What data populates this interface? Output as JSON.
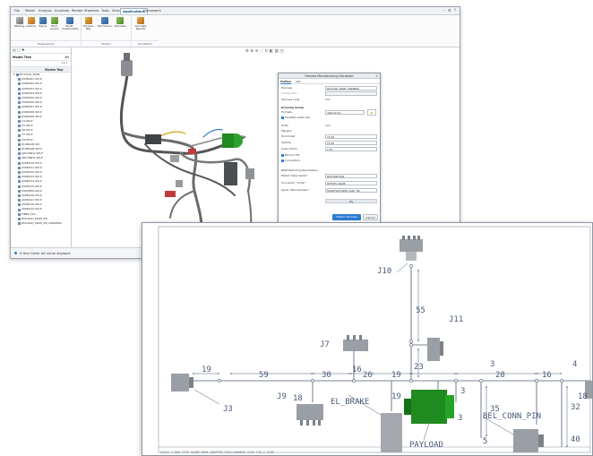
{
  "app": {
    "menu_tabs": [
      "File",
      "Model",
      "Analysis",
      "Annotate",
      "Render",
      "Standard",
      "Tools",
      "View",
      "Applications",
      "Framework"
    ],
    "active_tab": "Applications",
    "ribbon_buttons": [
      {
        "label": "Welding",
        "icon": "welding-icon"
      },
      {
        "label": "Cabling",
        "icon": "cabling-icon"
      },
      {
        "label": "Piping",
        "icon": "piping-icon"
      },
      {
        "label": "Mold\nLayout",
        "icon": "mold-layout-icon"
      },
      {
        "label": "ECAD\nCollaboration",
        "icon": "ecad-icon"
      },
      {
        "label": "Harness\nMfg",
        "icon": "harness-mfg-icon"
      },
      {
        "label": "Mechanism",
        "icon": "mechanism-icon"
      },
      {
        "label": "Simulate",
        "icon": "simulate-icon"
      },
      {
        "label": "Simulate\nResults",
        "icon": "simulate-results-icon"
      }
    ],
    "ribbon_groups": [
      "Engineering",
      "Motion",
      "Simulation"
    ],
    "model_tree": {
      "title": "Model Tree",
      "column_header": "Master Rep",
      "root": "PAYLOAD_MAIN",
      "items": [
        "ASM0001-SM-P",
        "ASM0002-SM-P",
        "ASM0003-SM-P",
        "ASM0004-SM-P",
        "ASM0005-SM-P",
        "ASM0006-SM-P",
        "ASM0007-SM-P",
        "ASM0008-SM-P",
        "ASM0009-SM-P",
        "C4-SM-P",
        "C5-SM-P",
        "C6-SM-P",
        "C7-SM-P",
        "C8-SM-P",
        "EL-BRAKE-SM",
        "EL-BRAKE-SM-P",
        "GROUND1-SM-P",
        "GROUND2-SM-P",
        "ASM0010-SM-P",
        "ASM0011-SM-P",
        "ASM0012-SM-P",
        "ASM0013-SM-P",
        "ASM0014-SM-P",
        "ASM0015-SM-P",
        "HARNESS-SM-P",
        "ASM0016-SM-P",
        "ASM0017-SM-P",
        "ASM0018-SM-P",
        "ASM0019-SM-P",
        "FIBER_001",
        "PAYLOAD_MAIN_SM",
        "PAYLOAD_MAIN_SM_DRAWING"
      ]
    },
    "status_text": "# Item Center will not be displayed",
    "view_toolbar_icons": [
      "zoom-icon",
      "zoom-in-icon",
      "zoom-out-icon",
      "refit-icon",
      "repaint-icon",
      "display-style-icon",
      "view-manager-icon",
      "saved-views-icon"
    ]
  },
  "dialog": {
    "title": "Harness Manufacturing Extraction",
    "tabs": [
      "Flatten",
      "Info"
    ],
    "active_tab": "Flatten",
    "harness_label": "Harness",
    "harness_value": "PAYLOAD_MAIN_HARNESS",
    "subharness_label": "Subharness",
    "harness_units_label": "Harness units",
    "harness_units_value": "mm",
    "drawing_setup_label": "Drawing Setup",
    "format_label": "Formats",
    "format_value": "default.frm",
    "variable_sheet_label": "Variable sheet size",
    "units_label": "Units",
    "units_value": "inch",
    "margins_label": "Margins",
    "horizontal_label": "Horizontal",
    "horizontal_value": "15.00",
    "vertical_label": "Vertical",
    "vertical_value": "15.00",
    "scale_label": "Scale Factor",
    "scale_value": "1.00",
    "bend_to_fit_label": "Bend to Fit",
    "connectors_label": "Connectors",
    "bom_section_label": "BOM Reporting Parameters",
    "model_desc_label": "Model \"Description\"",
    "model_desc_value": "DESCRIPTION",
    "connector_code_label": "Connector \"Code\"",
    "connector_code_value": "REFDES_NAME",
    "spool_part_label": "Spool \"Part Number\"",
    "spool_part_value": "MANUFACTURER_PART_NO",
    "progress": 0,
    "progress_text": "0%",
    "primary_button": "Flatten Harness",
    "cancel_button": "Cancel"
  },
  "drawing": {
    "labels": {
      "j10": "J10",
      "j11": "J11",
      "j7": "J7",
      "j9": "J9",
      "j3": "J3",
      "el_brake": "EL_BRAKE",
      "payload": "PAYLOAD",
      "bel_conn": "BEL_CONN_PIN"
    },
    "dimensions": [
      "55",
      "23",
      "19",
      "59",
      "30",
      "16",
      "26",
      "19",
      "28",
      "16",
      "4",
      "3",
      "18",
      "35",
      "3",
      "32",
      "40",
      "18",
      "5",
      "3"
    ],
    "title_block": "SCALE 1.000   TYPE ASSEM   NAME ADAPTER_PLUG_HARNESS   SIZE STD_C_SIZE"
  },
  "colors": {
    "accent": "#2b7bd3",
    "drawing_lines": "#4b5a79",
    "payload_green": "#1f8a1f",
    "connector_gray": "#9a9fa6"
  }
}
